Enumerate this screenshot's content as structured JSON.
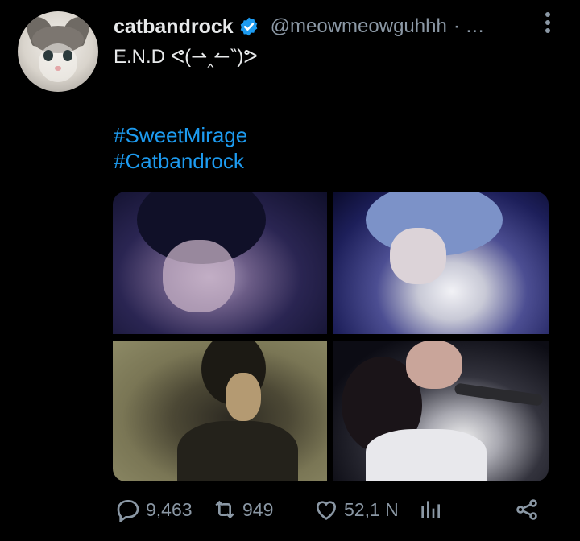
{
  "tweet": {
    "display_name": "catbandrock",
    "handle": "@meowmeowguhhh",
    "separator": "· …",
    "text": "E.N.D ᕙ(⇀‸↼‶)ᕗ",
    "hashtags": [
      "#SweetMirage",
      "#Catbandrock"
    ],
    "verified": true
  },
  "media": {
    "count": 4,
    "images": [
      {
        "name": "photo-1"
      },
      {
        "name": "photo-2"
      },
      {
        "name": "photo-3"
      },
      {
        "name": "photo-4"
      }
    ]
  },
  "actions": {
    "reply_count": "9,463",
    "retweet_count": "949",
    "like_count": "52,1 N",
    "icons": [
      "reply-icon",
      "retweet-icon",
      "like-icon",
      "analytics-icon",
      "share-icon"
    ]
  },
  "colors": {
    "background": "#000000",
    "text": "#e7e9ea",
    "secondary": "#8b98a5",
    "link": "#1d9bf0",
    "verified": "#1d9bf0"
  }
}
